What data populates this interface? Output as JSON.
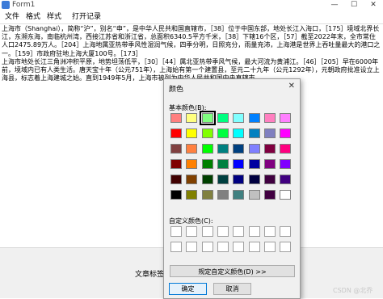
{
  "window": {
    "title": "Form1",
    "minimize_glyph": "—",
    "maximize_glyph": "☐",
    "close_glyph": "✕"
  },
  "menu": [
    "文件",
    "格式",
    "样式",
    "打开记录"
  ],
  "text_body": "上海市（Shanghai），简称“沪”，别名“申”，是中华人民共和国直辖市，［38］位于中国东部，地处长江入海口，［175］境域北界长江，东濒东海，南临杭州湾，西接江苏省和浙江省，总面积6340.5平方千米，［38］下辖16个区，［57］截至2022年末，全市常住人口2475.89万人。［204］上海地属亚热带季风性湿润气候，四季分明，日照充分，雨量充沛，上海港是世界上吞吐量最大的港口之一。［159］市政府驻地上海大厦100号。［173］\n上海市地处长江三角洲冲积平原，地势坦荡低平，［30］［44］属北亚热带季风气候，最大河流为黄浦江。［46］［205］早在6000年前，境域内已有人类生活。唐天宝十年（公元751年），上海始有第一个建置县，至元二十九年（公元1292年），元朝政府批准设立上海县，标志着上海建城之始。直到1949年5月，上海市被列为中华人民共和国中央直辖市。",
  "lower_panel": {
    "article_label": "文章标签"
  },
  "watermark": "CSDN @北乔",
  "color_dialog": {
    "title": "颜色",
    "close_glyph": "✕",
    "basic_colors_label": "基本颜色(B):",
    "custom_colors_label": "自定义颜色(C):",
    "define_custom_label": "规定自定义颜色(D) >>",
    "ok_label": "确定",
    "cancel_label": "取消",
    "selected_index": 2,
    "basic_colors": [
      "#ff8080",
      "#ffff80",
      "#80ff80",
      "#00ff80",
      "#80ffff",
      "#0080ff",
      "#ff80c0",
      "#ff80ff",
      "#ff0000",
      "#ffff00",
      "#80ff00",
      "#00ff40",
      "#00ffff",
      "#0080c0",
      "#8080c0",
      "#ff00ff",
      "#804040",
      "#ff8040",
      "#00ff00",
      "#008080",
      "#004080",
      "#8080ff",
      "#800040",
      "#ff0080",
      "#800000",
      "#ff8000",
      "#008000",
      "#008040",
      "#0000ff",
      "#0000a0",
      "#800080",
      "#8000ff",
      "#400000",
      "#804000",
      "#004000",
      "#004040",
      "#000080",
      "#000040",
      "#400040",
      "#400080",
      "#000000",
      "#808000",
      "#808040",
      "#808080",
      "#408080",
      "#c0c0c0",
      "#400040",
      "#ffffff"
    ],
    "custom_colors": [
      "#ffffff",
      "#ffffff",
      "#ffffff",
      "#ffffff",
      "#ffffff",
      "#ffffff",
      "#ffffff",
      "#ffffff",
      "#ffffff",
      "#ffffff",
      "#ffffff",
      "#ffffff",
      "#ffffff",
      "#ffffff",
      "#ffffff",
      "#ffffff"
    ]
  }
}
